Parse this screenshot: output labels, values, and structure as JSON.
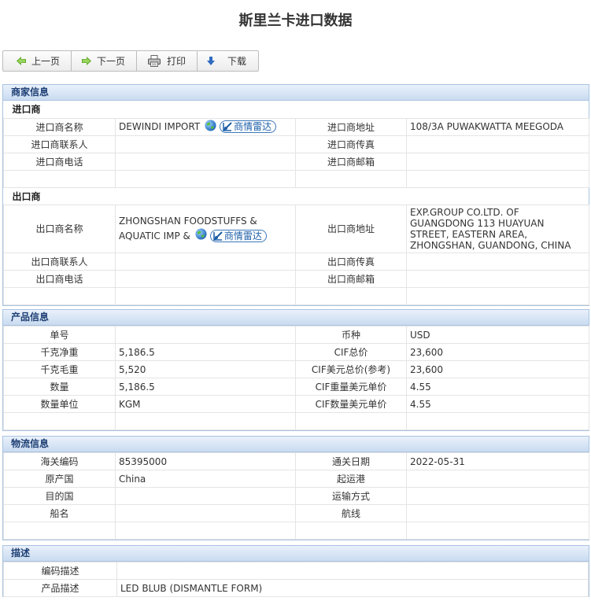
{
  "page": {
    "title": "斯里兰卡进口数据"
  },
  "toolbar": {
    "prev": "上一页",
    "next": "下一页",
    "print": "打印",
    "download": "下载"
  },
  "merchant": {
    "header": "商家信息",
    "importer_title": "进口商",
    "exporter_title": "出口商",
    "radar_label": "商情雷达",
    "importer": {
      "name_label": "进口商名称",
      "name": "DEWINDI IMPORT",
      "address_label": "进口商地址",
      "address": "108/3A PUWAKWATTA MEEGODA",
      "contact_label": "进口商联系人",
      "contact": "",
      "fax_label": "进口商传真",
      "fax": "",
      "phone_label": "进口商电话",
      "phone": "",
      "email_label": "进口商邮箱",
      "email": ""
    },
    "exporter": {
      "name_label": "出口商名称",
      "name_line1": "ZHONGSHAN FOODSTUFFS &",
      "name_line2": "AQUATIC IMP &",
      "address_label": "出口商地址",
      "address": "EXP.GROUP CO.LTD. OF GUANGDONG 113 HUAYUAN STREET, EASTERN AREA, ZHONGSHAN, GUANDONG, CHINA",
      "contact_label": "出口商联系人",
      "contact": "",
      "fax_label": "出口商传真",
      "fax": "",
      "phone_label": "出口商电话",
      "phone": "",
      "email_label": "出口商邮箱",
      "email": ""
    }
  },
  "product": {
    "header": "产品信息",
    "rows": [
      {
        "l1": "单号",
        "v1": "",
        "l2": "币种",
        "v2": "USD"
      },
      {
        "l1": "千克净重",
        "v1": "5,186.5",
        "l2": "CIF总价",
        "v2": "23,600"
      },
      {
        "l1": "千克毛重",
        "v1": "5,520",
        "l2": "CIF美元总价(参考)",
        "v2": "23,600"
      },
      {
        "l1": "数量",
        "v1": "5,186.5",
        "l2": "CIF重量美元单价",
        "v2": "4.55"
      },
      {
        "l1": "数量单位",
        "v1": "KGM",
        "l2": "CIF数量美元单价",
        "v2": "4.55"
      }
    ]
  },
  "logistics": {
    "header": "物流信息",
    "rows": [
      {
        "l1": "海关编码",
        "v1": "85395000",
        "l2": "通关日期",
        "v2": "2022-05-31"
      },
      {
        "l1": "原产国",
        "v1": "China",
        "l2": "起运港",
        "v2": ""
      },
      {
        "l1": "目的国",
        "v1": "",
        "l2": "运输方式",
        "v2": ""
      },
      {
        "l1": "船名",
        "v1": "",
        "l2": "航线",
        "v2": ""
      }
    ]
  },
  "description": {
    "header": "描述",
    "code_desc_label": "编码描述",
    "code_desc": "",
    "product_desc_label": "产品描述",
    "product_desc": "LED BLUB (DISMANTLE FORM)"
  },
  "colors": {
    "section_title": "#1e3f74",
    "section_border": "#a9c3e0",
    "radar": "#1d5fa8"
  },
  "icons": {
    "prev": "arrow-left-icon",
    "next": "arrow-right-icon",
    "print": "printer-icon",
    "download": "arrow-down-icon",
    "globe": "globe-icon",
    "radar": "radar-icon"
  }
}
